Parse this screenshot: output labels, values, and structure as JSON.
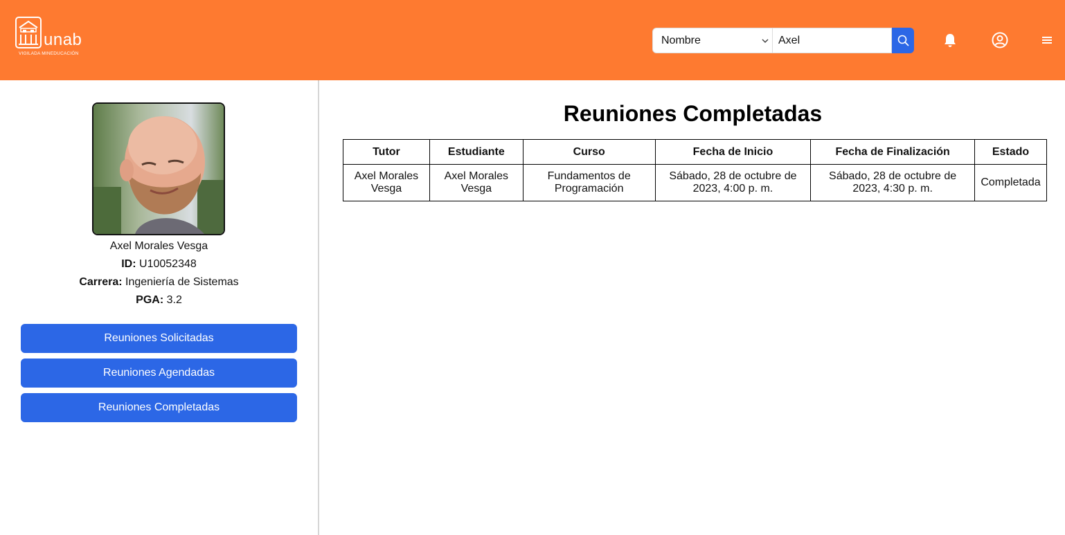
{
  "header": {
    "logo_text": "unab",
    "logo_subtext": "VIGILADA MINEDUCACIÓN",
    "search": {
      "filter_selected": "Nombre",
      "query_value": "Axel"
    },
    "icons": [
      "search-icon",
      "bell-icon",
      "user-circle-icon",
      "menu-icon"
    ],
    "accent_color": "#fe7a30",
    "button_color": "#2c67e6"
  },
  "profile": {
    "name": "Axel Morales Vesga",
    "id_label": "ID:",
    "id_value": "U10052348",
    "career_label": "Carrera:",
    "career_value": "Ingeniería de Sistemas",
    "pga_label": "PGA:",
    "pga_value": "3.2"
  },
  "sidebar": {
    "buttons": [
      {
        "label": "Reuniones Solicitadas"
      },
      {
        "label": "Reuniones Agendadas"
      },
      {
        "label": "Reuniones Completadas"
      }
    ]
  },
  "main": {
    "title": "Reuniones Completadas",
    "columns": [
      "Tutor",
      "Estudiante",
      "Curso",
      "Fecha de Inicio",
      "Fecha de Finalización",
      "Estado"
    ],
    "rows": [
      {
        "tutor": "Axel Morales Vesga",
        "student": "Axel Morales Vesga",
        "course": "Fundamentos de Programación",
        "start": "Sábado, 28 de octubre de 2023, 4:00 p. m.",
        "end": "Sábado, 28 de octubre de 2023, 4:30 p. m.",
        "status": "Completada"
      }
    ]
  }
}
